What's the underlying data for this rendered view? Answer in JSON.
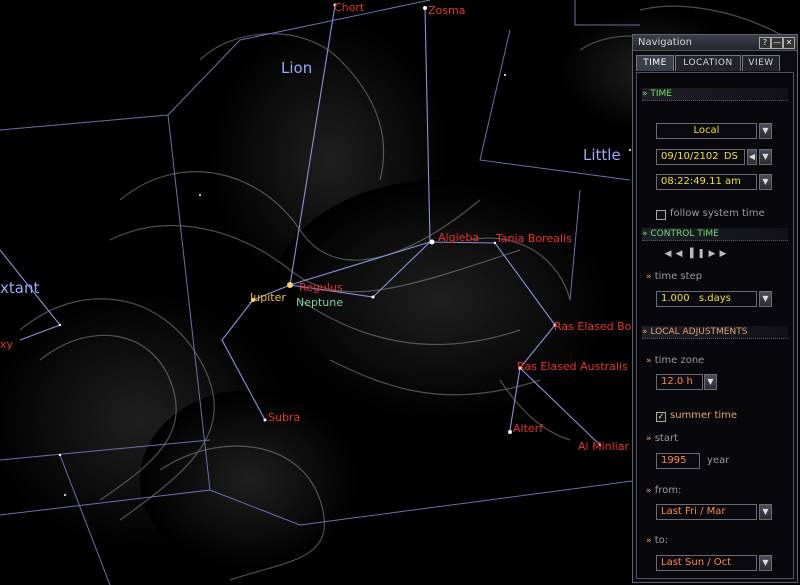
{
  "sky": {
    "constellations": [
      {
        "id": "lion",
        "text": "Lion"
      },
      {
        "id": "little",
        "text": "Little"
      },
      {
        "id": "sextant",
        "text": "xtant"
      }
    ],
    "stars": [
      {
        "id": "chort",
        "text": "Chort"
      },
      {
        "id": "zosma",
        "text": "Zosma"
      },
      {
        "id": "algieba",
        "text": "Algieba"
      },
      {
        "id": "tania-borealis",
        "text": "Tania Borealis"
      },
      {
        "id": "regulus",
        "text": "Regulus"
      },
      {
        "id": "ras-elased-b",
        "text": "Ras Elased Bo"
      },
      {
        "id": "ras-elased-a",
        "text": "Ras Elased Australis"
      },
      {
        "id": "subra",
        "text": "Subra"
      },
      {
        "id": "alterf",
        "text": "Alterf"
      },
      {
        "id": "al-minliar",
        "text": "Al Minliar al"
      },
      {
        "id": "edge-xy",
        "text": "xy"
      }
    ],
    "planets": [
      {
        "id": "jupiter",
        "text": "Jupiter"
      },
      {
        "id": "neptune",
        "text": "Neptune"
      }
    ]
  },
  "nav": {
    "title": "Navigation",
    "title_buttons": [
      "?",
      "—",
      "✕"
    ],
    "tabs": [
      {
        "label": "TIME",
        "active": true
      },
      {
        "label": "LOCATION",
        "active": false
      },
      {
        "label": "VIEW",
        "active": false
      }
    ],
    "time_section": "TIME",
    "timezone_mode": "Local",
    "date": "09/10/2102",
    "date_suffix": "DS",
    "time": "08:22:49.11 am",
    "follow_system_time": "follow system time",
    "control_time_section": "CONTROL TIME",
    "control_buttons": [
      "◀",
      "◀",
      "▐",
      "❚",
      "▶",
      "▶"
    ],
    "time_step_label": "time step",
    "time_step_value": "1.000",
    "time_step_unit": "s.days",
    "local_adjustments_section": "LOCAL ADJUSTMENTS",
    "time_zone_label": "time zone",
    "time_zone_value": "12.0 h",
    "summer_time_label": "summer time",
    "summer_time_checked": true,
    "start_label": "start",
    "start_value": "1995",
    "start_unit": "year",
    "from_label": "from:",
    "from_value": "Last   Fri  /  Mar",
    "to_label": "to:",
    "to_value": "Last   Sun  /  Oct",
    "arrow": "»",
    "dropdown_glyph": "▼"
  },
  "colors": {
    "star_label": "#e8332e",
    "planet_label": "#f0c040",
    "constellation_label": "#9ea6ff",
    "panel_accent_green": "#6fe06a",
    "panel_accent_orange": "#e8a070",
    "field_value": "#f0e030"
  }
}
